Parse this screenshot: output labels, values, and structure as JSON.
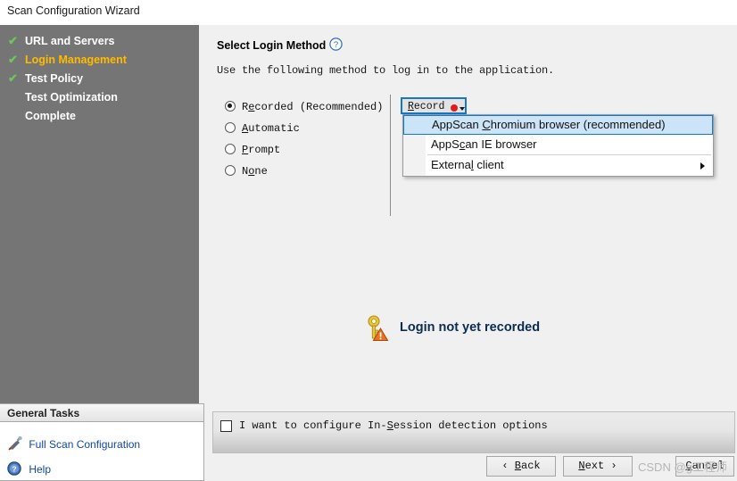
{
  "window": {
    "title": "Scan Configuration Wizard"
  },
  "sidebar": {
    "steps": [
      {
        "label": "URL and Servers",
        "state": "done",
        "check": "✔"
      },
      {
        "label": "Login Management",
        "state": "current",
        "check": "✔"
      },
      {
        "label": "Test Policy",
        "state": "done",
        "check": "✔"
      },
      {
        "label": "Test Optimization",
        "state": "todo",
        "check": ""
      },
      {
        "label": "Complete",
        "state": "todo",
        "check": ""
      }
    ],
    "general_tasks": {
      "header": "General Tasks",
      "items": [
        {
          "label": "Full Scan Configuration",
          "icon": "tools-icon"
        },
        {
          "label": "Help",
          "icon": "help-icon"
        }
      ]
    }
  },
  "main": {
    "section_title": "Select Login Method",
    "help_icon": "question-mark-icon",
    "subtitle": "Use the following method to log in to the application.",
    "login_methods": [
      {
        "label_pre": "R",
        "mnemonic": "e",
        "label_post": "corded (Recommended)",
        "selected": true
      },
      {
        "label_pre": "",
        "mnemonic": "A",
        "label_post": "utomatic",
        "selected": false
      },
      {
        "label_pre": "",
        "mnemonic": "P",
        "label_post": "rompt",
        "selected": false
      },
      {
        "label_pre": "N",
        "mnemonic": "o",
        "label_post": "ne",
        "selected": false
      }
    ],
    "record_button": {
      "label_pre": "",
      "mnemonic": "R",
      "label_post": "ecord",
      "dot_color": "#e01b1b",
      "focus_color": "#1578c8"
    },
    "record_menu": [
      {
        "pre": "AppScan ",
        "mnemonic": "C",
        "post": "hromium browser   (recommended)",
        "selected": true,
        "submenu": false
      },
      {
        "pre": "AppS",
        "mnemonic": "c",
        "post": "an IE browser",
        "selected": false,
        "submenu": false
      },
      {
        "pre": "Externa",
        "mnemonic": "l",
        "post": " client",
        "selected": false,
        "submenu": true
      }
    ],
    "status": {
      "text": "Login not yet recorded",
      "icon": "key-warning-icon",
      "text_color": "#0c2a52"
    },
    "options": {
      "checkbox_checked": false,
      "label_pre": "I want to configure In-",
      "mnemonic": "S",
      "label_post": "ession detection options"
    }
  },
  "footer": {
    "back": "‹  Back",
    "back_pre": "‹  ",
    "back_mn": "B",
    "back_post": "ack",
    "next_pre": "",
    "next_mn": "N",
    "next_post": "ext  ›",
    "cancel_pre": "",
    "cancel_mn": "C",
    "cancel_post": "ancel"
  },
  "watermark": {
    "text": "CSDN @g工程师"
  },
  "colors": {
    "sidebar_bg": "#757575",
    "current_step": "#ffbb00",
    "check": "#6fc45a",
    "accent_blue": "#1578c8",
    "menu_selected_bg": "#cce4f7",
    "link_blue": "#11469e",
    "record_red": "#e01b1b"
  }
}
